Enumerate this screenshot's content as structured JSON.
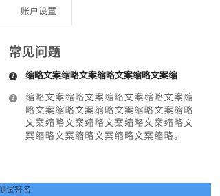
{
  "header": {
    "account_settings": "账户设置"
  },
  "faq": {
    "title": "常见问题",
    "question_marker": "?",
    "answer_marker": "?",
    "question": "缩略文案缩略文案缩略文案缩略文案缩",
    "answer": "缩略文案缩略文案缩略文案缩略文案缩略文案缩略文案缩略文案缩略文案缩略文案缩略文案缩略文案缩略文案缩略文案缩略文案缩略文案缩略文案缩略。"
  },
  "bottom_bar": {
    "text": "测试签名"
  },
  "colors": {
    "bottom_bar": "#4b9af0",
    "question_mark": "#333333",
    "answer_mark": "#8a8a8a"
  }
}
